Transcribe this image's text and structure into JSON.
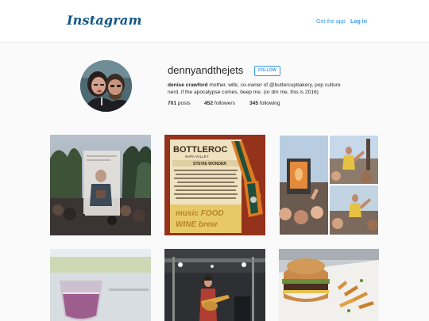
{
  "header": {
    "logo": "Instagram",
    "get_app": "Get the app",
    "login": "Log in"
  },
  "profile": {
    "username": "dennyandthejets",
    "follow_label": "FOLLOW",
    "full_name": "denise crawford",
    "bio": "mother, wife, co-owner of @buttercupbakery, pop culture nerd. if the apocalypse comes, beep me. (or dm me, this is 2016)",
    "stats": {
      "posts_count": "701",
      "posts_label": "posts",
      "followers_count": "452",
      "followers_label": "followers",
      "following_count": "345",
      "following_label": "following"
    }
  },
  "posts": {
    "post2": {
      "sign_line1": "BOTTLEROC",
      "sign_line2": "NAPA VALLEY",
      "sign_line3": "STEVIE WONDER",
      "sign_bottom1": "music FOOD",
      "sign_bottom2": "WINE brew"
    }
  },
  "colors": {
    "logo": "#125688",
    "link": "#3897f0",
    "text": "#262626",
    "page_bg": "#fafafa"
  }
}
